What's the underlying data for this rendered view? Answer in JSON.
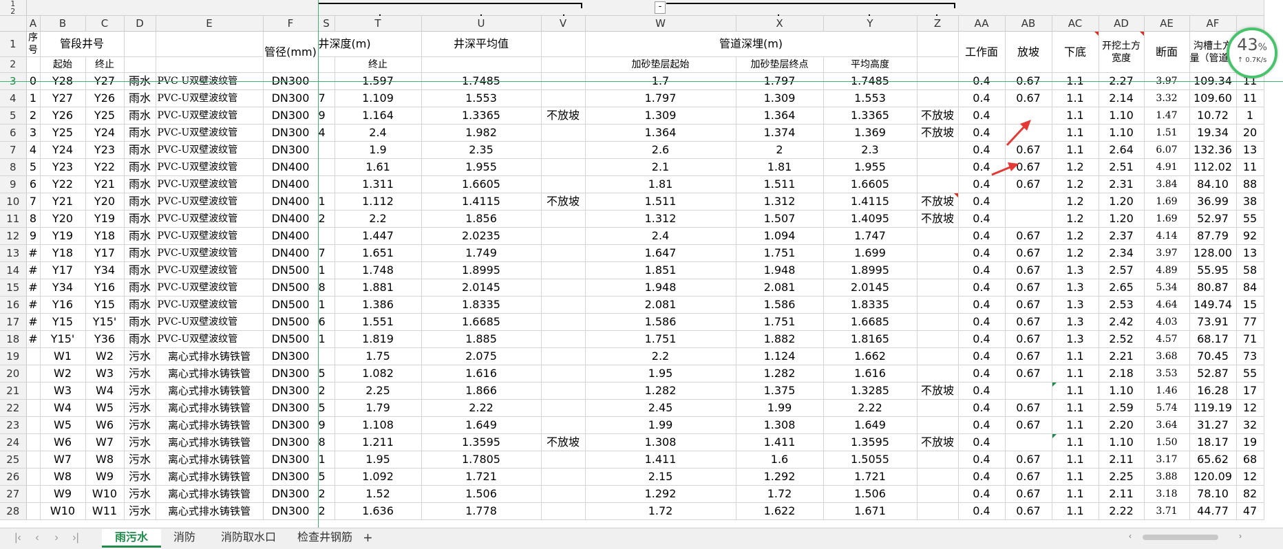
{
  "outline_levels": [
    "1",
    "2"
  ],
  "column_letters": [
    "A",
    "B",
    "C",
    "D",
    "E",
    "F",
    "S",
    "T",
    "U",
    "V",
    "W",
    "X",
    "Y",
    "Z",
    "AA",
    "AB",
    "AC",
    "AD",
    "AE",
    "AF"
  ],
  "header_row1": {
    "seq": "序号",
    "segment": "管段井号",
    "diameter": "管径(mm)",
    "well_depth": "井深度(m)",
    "well_depth_cut": "井深度(m)",
    "well_avg": "井深平均值",
    "pipe_depth": "管道深埋(m)",
    "work_face": "工作面",
    "slope": "放坡",
    "bottom": "下底",
    "excav_width": "开挖土方宽度",
    "section": "断面",
    "trench": "沟槽土方量（管道）"
  },
  "header_row2": {
    "start": "起始",
    "end": "终止",
    "well_end": "终止",
    "sand_start": "加砂垫层起始",
    "sand_end": "加砂垫层终点",
    "avg_height": "平均高度"
  },
  "rows": [
    {
      "rn": "3",
      "a": "0",
      "b": "Y28",
      "c": "Y27",
      "d": "雨水",
      "e": "PVC-U双壁波纹管",
      "f": "DN300",
      "s": "",
      "t": "1.597",
      "u": "1.7485",
      "v": "",
      "w": "1.7",
      "x": "1.797",
      "y": "1.7485",
      "z": "",
      "aa": "0.4",
      "ab": "0.67",
      "ac": "1.1",
      "ad": "2.27",
      "ae": "3.97",
      "af": "109.34",
      "ag": "11"
    },
    {
      "rn": "4",
      "a": "1",
      "b": "Y27",
      "c": "Y26",
      "d": "雨水",
      "e": "PVC-U双壁波纹管",
      "f": "DN300",
      "s": "7",
      "t": "1.109",
      "u": "1.553",
      "v": "",
      "w": "1.797",
      "x": "1.309",
      "y": "1.553",
      "z": "",
      "aa": "0.4",
      "ab": "0.67",
      "ac": "1.1",
      "ad": "2.14",
      "ae": "3.32",
      "af": "109.60",
      "ag": "11"
    },
    {
      "rn": "5",
      "a": "2",
      "b": "Y26",
      "c": "Y25",
      "d": "雨水",
      "e": "PVC-U双壁波纹管",
      "f": "DN300",
      "s": "9",
      "t": "1.164",
      "u": "1.3365",
      "v": "不放坡",
      "w": "1.309",
      "x": "1.364",
      "y": "1.3365",
      "z": "不放坡",
      "aa": "0.4",
      "ab": "",
      "ac": "1.1",
      "ad": "1.10",
      "ae": "1.47",
      "af": "10.72",
      "ag": "1"
    },
    {
      "rn": "6",
      "a": "3",
      "b": "Y25",
      "c": "Y24",
      "d": "雨水",
      "e": "PVC-U双壁波纹管",
      "f": "DN300",
      "s": "4",
      "t": "2.4",
      "u": "1.982",
      "v": "",
      "w": "1.364",
      "x": "1.374",
      "y": "1.369",
      "z": "不放坡",
      "aa": "0.4",
      "ab": "",
      "ac": "1.1",
      "ad": "1.10",
      "ae": "1.51",
      "af": "19.34",
      "ag": "20"
    },
    {
      "rn": "7",
      "a": "4",
      "b": "Y24",
      "c": "Y23",
      "d": "雨水",
      "e": "PVC-U双壁波纹管",
      "f": "DN300",
      "s": "",
      "t": "1.9",
      "u": "2.35",
      "v": "",
      "w": "2.6",
      "x": "2",
      "y": "2.3",
      "z": "",
      "aa": "0.4",
      "ab": "0.67",
      "ac": "1.1",
      "ad": "2.64",
      "ae": "6.07",
      "af": "132.36",
      "ag": "13"
    },
    {
      "rn": "8",
      "a": "5",
      "b": "Y23",
      "c": "Y22",
      "d": "雨水",
      "e": "PVC-U双壁波纹管",
      "f": "DN400",
      "s": "",
      "t": "1.61",
      "u": "1.955",
      "v": "",
      "w": "2.1",
      "x": "1.81",
      "y": "1.955",
      "z": "",
      "aa": "0.4",
      "ab": "0.67",
      "ac": "1.2",
      "ad": "2.51",
      "ae": "4.91",
      "af": "112.02",
      "ag": "11"
    },
    {
      "rn": "9",
      "a": "6",
      "b": "Y22",
      "c": "Y21",
      "d": "雨水",
      "e": "PVC-U双壁波纹管",
      "f": "DN400",
      "s": "",
      "t": "1.311",
      "u": "1.6605",
      "v": "",
      "w": "1.81",
      "x": "1.511",
      "y": "1.6605",
      "z": "",
      "aa": "0.4",
      "ab": "0.67",
      "ac": "1.2",
      "ad": "2.31",
      "ae": "3.84",
      "af": "84.10",
      "ag": "88"
    },
    {
      "rn": "10",
      "a": "7",
      "b": "Y21",
      "c": "Y20",
      "d": "雨水",
      "e": "PVC-U双壁波纹管",
      "f": "DN400",
      "s": "1",
      "t": "1.112",
      "u": "1.4115",
      "v": "不放坡",
      "w": "1.511",
      "x": "1.312",
      "y": "1.4115",
      "z": "不放坡",
      "aa": "0.4",
      "ab": "",
      "ac": "1.2",
      "ad": "1.20",
      "ae": "1.69",
      "af": "36.99",
      "ag": "38"
    },
    {
      "rn": "11",
      "a": "8",
      "b": "Y20",
      "c": "Y19",
      "d": "雨水",
      "e": "PVC-U双壁波纹管",
      "f": "DN400",
      "s": "2",
      "t": "2.2",
      "u": "1.856",
      "v": "",
      "w": "1.312",
      "x": "1.507",
      "y": "1.4095",
      "z": "不放坡",
      "aa": "0.4",
      "ab": "",
      "ac": "1.2",
      "ad": "1.20",
      "ae": "1.69",
      "af": "52.97",
      "ag": "55"
    },
    {
      "rn": "12",
      "a": "9",
      "b": "Y19",
      "c": "Y18",
      "d": "雨水",
      "e": "PVC-U双壁波纹管",
      "f": "DN400",
      "s": "",
      "t": "1.447",
      "u": "2.0235",
      "v": "",
      "w": "2.4",
      "x": "1.094",
      "y": "1.747",
      "z": "",
      "aa": "0.4",
      "ab": "0.67",
      "ac": "1.2",
      "ad": "2.37",
      "ae": "4.14",
      "af": "87.79",
      "ag": "92"
    },
    {
      "rn": "13",
      "a": "#",
      "b": "Y18",
      "c": "Y17",
      "d": "雨水",
      "e": "PVC-U双壁波纹管",
      "f": "DN400",
      "s": "7",
      "t": "1.651",
      "u": "1.749",
      "v": "",
      "w": "1.647",
      "x": "1.751",
      "y": "1.699",
      "z": "",
      "aa": "0.4",
      "ab": "0.67",
      "ac": "1.2",
      "ad": "2.34",
      "ae": "3.97",
      "af": "128.00",
      "ag": "13"
    },
    {
      "rn": "14",
      "a": "#",
      "b": "Y17",
      "c": "Y34",
      "d": "雨水",
      "e": "PVC-U双壁波纹管",
      "f": "DN500",
      "s": "1",
      "t": "1.748",
      "u": "1.8995",
      "v": "",
      "w": "1.851",
      "x": "1.948",
      "y": "1.8995",
      "z": "",
      "aa": "0.4",
      "ab": "0.67",
      "ac": "1.3",
      "ad": "2.57",
      "ae": "4.89",
      "af": "55.95",
      "ag": "58"
    },
    {
      "rn": "15",
      "a": "#",
      "b": "Y34",
      "c": "Y16",
      "d": "雨水",
      "e": "PVC-U双壁波纹管",
      "f": "DN500",
      "s": "8",
      "t": "1.881",
      "u": "2.0145",
      "v": "",
      "w": "1.948",
      "x": "2.081",
      "y": "2.0145",
      "z": "",
      "aa": "0.4",
      "ab": "0.67",
      "ac": "1.3",
      "ad": "2.65",
      "ae": "5.34",
      "af": "80.87",
      "ag": "84"
    },
    {
      "rn": "16",
      "a": "#",
      "b": "Y16",
      "c": "Y15",
      "d": "雨水",
      "e": "PVC-U双壁波纹管",
      "f": "DN500",
      "s": "1",
      "t": "1.386",
      "u": "1.8335",
      "v": "",
      "w": "2.081",
      "x": "1.586",
      "y": "1.8335",
      "z": "",
      "aa": "0.4",
      "ab": "0.67",
      "ac": "1.3",
      "ad": "2.53",
      "ae": "4.64",
      "af": "149.74",
      "ag": "15"
    },
    {
      "rn": "17",
      "a": "#",
      "b": "Y15",
      "c": "Y15'",
      "d": "雨水",
      "e": "PVC-U双壁波纹管",
      "f": "DN500",
      "s": "6",
      "t": "1.551",
      "u": "1.6685",
      "v": "",
      "w": "1.586",
      "x": "1.751",
      "y": "1.6685",
      "z": "",
      "aa": "0.4",
      "ab": "0.67",
      "ac": "1.3",
      "ad": "2.42",
      "ae": "4.03",
      "af": "73.91",
      "ag": "77"
    },
    {
      "rn": "18",
      "a": "#",
      "b": "Y15'",
      "c": "Y36",
      "d": "雨水",
      "e": "PVC-U双壁波纹管",
      "f": "DN500",
      "s": "1",
      "t": "1.819",
      "u": "1.885",
      "v": "",
      "w": "1.751",
      "x": "1.882",
      "y": "1.8165",
      "z": "",
      "aa": "0.4",
      "ab": "0.67",
      "ac": "1.3",
      "ad": "2.52",
      "ae": "4.57",
      "af": "68.17",
      "ag": "71"
    },
    {
      "rn": "19",
      "a": "",
      "b": "W1",
      "c": "W2",
      "d": "污水",
      "e": "离心式排水铸铁管",
      "f": "DN300",
      "s": "",
      "t": "1.75",
      "u": "2.075",
      "v": "",
      "w": "2.2",
      "x": "1.124",
      "y": "1.662",
      "z": "",
      "aa": "0.4",
      "ab": "0.67",
      "ac": "1.1",
      "ad": "2.21",
      "ae": "3.68",
      "af": "70.45",
      "ag": "73"
    },
    {
      "rn": "20",
      "a": "",
      "b": "W2",
      "c": "W3",
      "d": "污水",
      "e": "离心式排水铸铁管",
      "f": "DN300",
      "s": "5",
      "t": "1.082",
      "u": "1.616",
      "v": "",
      "w": "1.95",
      "x": "1.282",
      "y": "1.616",
      "z": "",
      "aa": "0.4",
      "ab": "0.67",
      "ac": "1.1",
      "ad": "2.18",
      "ae": "3.53",
      "af": "52.87",
      "ag": "55"
    },
    {
      "rn": "21",
      "a": "",
      "b": "W3",
      "c": "W4",
      "d": "污水",
      "e": "离心式排水铸铁管",
      "f": "DN300",
      "s": "2",
      "t": "2.25",
      "u": "1.866",
      "v": "",
      "w": "1.282",
      "x": "1.375",
      "y": "1.3285",
      "z": "不放坡",
      "aa": "0.4",
      "ab": "",
      "ac": "1.1",
      "ad": "1.10",
      "ae": "1.46",
      "af": "16.28",
      "ag": "17"
    },
    {
      "rn": "22",
      "a": "",
      "b": "W4",
      "c": "W5",
      "d": "污水",
      "e": "离心式排水铸铁管",
      "f": "DN300",
      "s": "5",
      "t": "1.79",
      "u": "2.22",
      "v": "",
      "w": "2.45",
      "x": "1.99",
      "y": "2.22",
      "z": "",
      "aa": "0.4",
      "ab": "0.67",
      "ac": "1.1",
      "ad": "2.59",
      "ae": "5.74",
      "af": "119.19",
      "ag": "12"
    },
    {
      "rn": "23",
      "a": "",
      "b": "W5",
      "c": "W6",
      "d": "污水",
      "e": "离心式排水铸铁管",
      "f": "DN300",
      "s": "9",
      "t": "1.108",
      "u": "1.649",
      "v": "",
      "w": "1.99",
      "x": "1.308",
      "y": "1.649",
      "z": "",
      "aa": "0.4",
      "ab": "0.67",
      "ac": "1.1",
      "ad": "2.20",
      "ae": "3.64",
      "af": "31.27",
      "ag": "32"
    },
    {
      "rn": "24",
      "a": "",
      "b": "W6",
      "c": "W7",
      "d": "污水",
      "e": "离心式排水铸铁管",
      "f": "DN300",
      "s": "8",
      "t": "1.211",
      "u": "1.3595",
      "v": "不放坡",
      "w": "1.308",
      "x": "1.411",
      "y": "1.3595",
      "z": "不放坡",
      "aa": "0.4",
      "ab": "",
      "ac": "1.1",
      "ad": "1.10",
      "ae": "1.50",
      "af": "18.17",
      "ag": "19"
    },
    {
      "rn": "25",
      "a": "",
      "b": "W7",
      "c": "W8",
      "d": "污水",
      "e": "离心式排水铸铁管",
      "f": "DN300",
      "s": "1",
      "t": "1.95",
      "u": "1.7805",
      "v": "",
      "w": "1.411",
      "x": "1.6",
      "y": "1.5055",
      "z": "",
      "aa": "0.4",
      "ab": "0.67",
      "ac": "1.1",
      "ad": "2.11",
      "ae": "3.17",
      "af": "65.62",
      "ag": "68"
    },
    {
      "rn": "26",
      "a": "",
      "b": "W8",
      "c": "W9",
      "d": "污水",
      "e": "离心式排水铸铁管",
      "f": "DN300",
      "s": "5",
      "t": "1.092",
      "u": "1.721",
      "v": "",
      "w": "2.15",
      "x": "1.292",
      "y": "1.721",
      "z": "",
      "aa": "0.4",
      "ab": "0.67",
      "ac": "1.1",
      "ad": "2.25",
      "ae": "3.88",
      "af": "120.09",
      "ag": "12"
    },
    {
      "rn": "27",
      "a": "",
      "b": "W9",
      "c": "W10",
      "d": "污水",
      "e": "离心式排水铸铁管",
      "f": "DN300",
      "s": "2",
      "t": "1.52",
      "u": "1.506",
      "v": "",
      "w": "1.292",
      "x": "1.72",
      "y": "1.506",
      "z": "",
      "aa": "0.4",
      "ab": "0.67",
      "ac": "1.1",
      "ad": "2.11",
      "ae": "3.18",
      "af": "78.10",
      "ag": "82"
    },
    {
      "rn": "28",
      "a": "",
      "b": "W10",
      "c": "W11",
      "d": "污水",
      "e": "离心式排水铸铁管",
      "f": "DN300",
      "s": "2",
      "t": "1.636",
      "u": "1.778",
      "v": "",
      "w": "1.72",
      "x": "1.622",
      "y": "1.671",
      "z": "",
      "aa": "0.4",
      "ab": "0.67",
      "ac": "1.1",
      "ad": "2.22",
      "ae": "3.71",
      "af": "44.77",
      "ag": "47"
    }
  ],
  "speed_widget": {
    "percent": "43",
    "percent_unit": "%",
    "rate": "0.7K/s",
    "rate_arrow": "↑"
  },
  "sheet_tabs": [
    "雨污水",
    "消防",
    "消防取水口",
    "检查井钢筋"
  ],
  "active_tab": "雨污水",
  "nav_icons": [
    "first-sheet-icon",
    "prev-sheet-icon",
    "next-sheet-icon",
    "last-sheet-icon"
  ],
  "add_tab_label": "+",
  "outline_button_label": "-",
  "colors": {
    "accent": "#1d8c4a",
    "comment_marker": "#d93025",
    "arrow": "#e53935",
    "speed_ring": "#47c46b"
  }
}
